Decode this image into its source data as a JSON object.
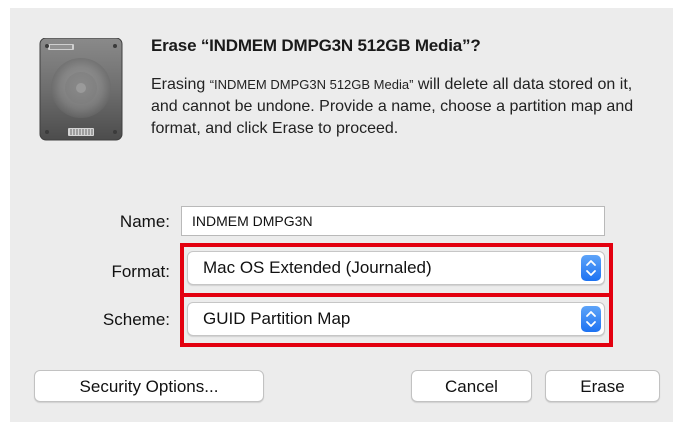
{
  "dialog": {
    "title": "Erase “INDMEM DMPG3N 512GB Media”?",
    "message_prefix": "Erasing ",
    "message_disk": "“INDMEM DMPG3N 512GB Media”",
    "message_suffix": " will delete all data stored on it, and cannot be undone. Provide a name, choose a partition map and format, and click Erase to proceed.",
    "icon": "hard-drive-icon"
  },
  "form": {
    "name_label": "Name:",
    "name_value": "INDMEM DMPG3N",
    "format_label": "Format:",
    "format_value": "Mac OS Extended (Journaled)",
    "scheme_label": "Scheme:",
    "scheme_value": "GUID Partition Map"
  },
  "buttons": {
    "security_options": "Security Options...",
    "cancel": "Cancel",
    "erase": "Erase"
  },
  "colors": {
    "highlight": "#e3000f",
    "stepper_accent": "#1d72f2"
  }
}
